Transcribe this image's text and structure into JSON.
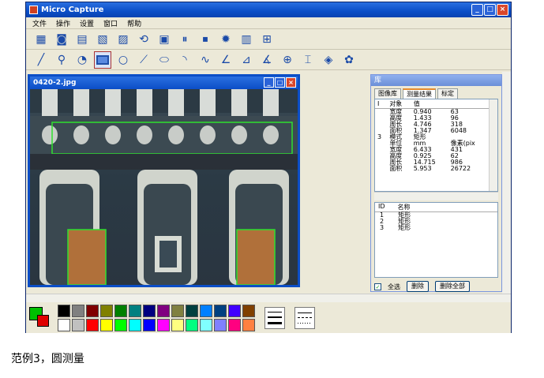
{
  "window": {
    "title": "Micro Capture"
  },
  "menu": [
    "文件",
    "操作",
    "设置",
    "窗口",
    "帮助"
  ],
  "toolbar1": [
    {
      "name": "video-icon",
      "glyph": "▦"
    },
    {
      "name": "camera-icon",
      "glyph": "◙"
    },
    {
      "name": "folder-open-icon",
      "glyph": "▤"
    },
    {
      "name": "image-icon",
      "glyph": "▧"
    },
    {
      "name": "image-export-icon",
      "glyph": "▨"
    },
    {
      "name": "refresh-icon",
      "glyph": "⟲"
    },
    {
      "name": "save-icon",
      "glyph": "▣"
    },
    {
      "name": "pause-icon",
      "glyph": "⏸"
    },
    {
      "name": "stop-icon",
      "glyph": "⏹"
    },
    {
      "name": "settings-icon",
      "glyph": "✹"
    },
    {
      "name": "ruler-icon",
      "glyph": "▥"
    },
    {
      "name": "scale-bar-icon",
      "glyph": "⊞"
    }
  ],
  "toolbar2": [
    {
      "name": "line-tool-icon",
      "glyph": "╱"
    },
    {
      "name": "zoom-icon",
      "glyph": "⚲"
    },
    {
      "name": "circle-three-point-icon",
      "glyph": "◔"
    },
    {
      "name": "rectangle-tool-icon",
      "glyph": "rect"
    },
    {
      "name": "circle-tool-icon",
      "glyph": "○"
    },
    {
      "name": "polyline-tool-icon",
      "glyph": "⟋"
    },
    {
      "name": "ellipse-tool-icon",
      "glyph": "⬭"
    },
    {
      "name": "arc-tool-icon",
      "glyph": "◝"
    },
    {
      "name": "curve-tool-icon",
      "glyph": "∿"
    },
    {
      "name": "angle-tool-icon",
      "glyph": "∠"
    },
    {
      "name": "angle-measure-icon",
      "glyph": "⊿"
    },
    {
      "name": "protractor-icon",
      "glyph": "∡"
    },
    {
      "name": "center-line-icon",
      "glyph": "⊕"
    },
    {
      "name": "height-tool-icon",
      "glyph": "⌶"
    },
    {
      "name": "diamond-tool-icon",
      "glyph": "◈"
    },
    {
      "name": "color-palette-icon",
      "glyph": "✿"
    }
  ],
  "child_window": {
    "title": "0420-2.jpg"
  },
  "panel": {
    "title": "库",
    "tabs": [
      "图像库",
      "测量结果",
      "标定"
    ],
    "grid_headers": [
      "I",
      "对象",
      "值"
    ],
    "grid_rows": [
      [
        "",
        "宽度",
        "0.940",
        "63"
      ],
      [
        "",
        "高度",
        "1.433",
        "96"
      ],
      [
        "",
        "周长",
        "4.746",
        "318"
      ],
      [
        "",
        "面积",
        "1.347",
        "6048"
      ],
      [
        "3",
        "模式",
        "矩形",
        ""
      ],
      [
        "",
        "单位",
        "mm",
        "像素(pix"
      ],
      [
        "",
        "宽度",
        "6.433",
        "431"
      ],
      [
        "",
        "高度",
        "0.925",
        "62"
      ],
      [
        "",
        "周长",
        "14.715",
        "986"
      ],
      [
        "",
        "面积",
        "5.953",
        "26722"
      ]
    ],
    "list_headers": [
      "ID",
      "名称"
    ],
    "list_rows": [
      [
        "1",
        "矩形"
      ],
      [
        "2",
        "矩形"
      ],
      [
        "3",
        "矩形"
      ]
    ],
    "select_all_label": "全选",
    "delete_label": "删除",
    "delete_all_label": "删除全部"
  },
  "palette": {
    "foreground": "#00c000",
    "background": "#e00000",
    "colors": [
      "#000000",
      "#808080",
      "#800000",
      "#808000",
      "#008000",
      "#008080",
      "#000080",
      "#800080",
      "#808040",
      "#004040",
      "#0080ff",
      "#004080",
      "#4000ff",
      "#804000",
      "#ffffff",
      "#c0c0c0",
      "#ff0000",
      "#ffff00",
      "#00ff00",
      "#00ffff",
      "#0000ff",
      "#ff00ff",
      "#ffff80",
      "#00ff80",
      "#80ffff",
      "#8080ff",
      "#ff0080",
      "#ff8040"
    ]
  },
  "caption": "范例3，圆测量"
}
